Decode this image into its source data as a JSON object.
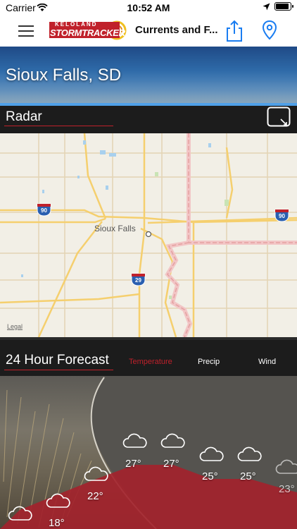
{
  "status_bar": {
    "carrier": "Carrier",
    "time": "10:52 AM"
  },
  "nav": {
    "logo_top": "KELOLAND",
    "logo_main": "STORMTRACKER",
    "title": "Currents and F..."
  },
  "location": {
    "city": "Sioux Falls, SD"
  },
  "radar": {
    "title": "Radar",
    "map_city_label": "Sioux Falls",
    "legal": "Legal",
    "shields": [
      "90",
      "90",
      "29"
    ]
  },
  "forecast": {
    "title": "24 Hour Forecast",
    "tabs": [
      {
        "label": "Temperature",
        "color": "#c0212b"
      },
      {
        "label": "Precip",
        "color": "#ffffff"
      },
      {
        "label": "Wind",
        "color": "#ffffff"
      }
    ],
    "temperatures": [
      "18°",
      "22°",
      "27°",
      "27°",
      "25°",
      "25°",
      "23°"
    ],
    "icons": [
      "cloud-icon",
      "cloud-icon",
      "cloud-icon",
      "cloud-icon",
      "cloud-icon",
      "cloud-icon",
      "cloud-icon",
      "cloud-icon"
    ]
  },
  "colors": {
    "accent_red": "#c0212b",
    "accent_blue": "#1a7df1",
    "dark_bg": "#1c1c1c"
  }
}
